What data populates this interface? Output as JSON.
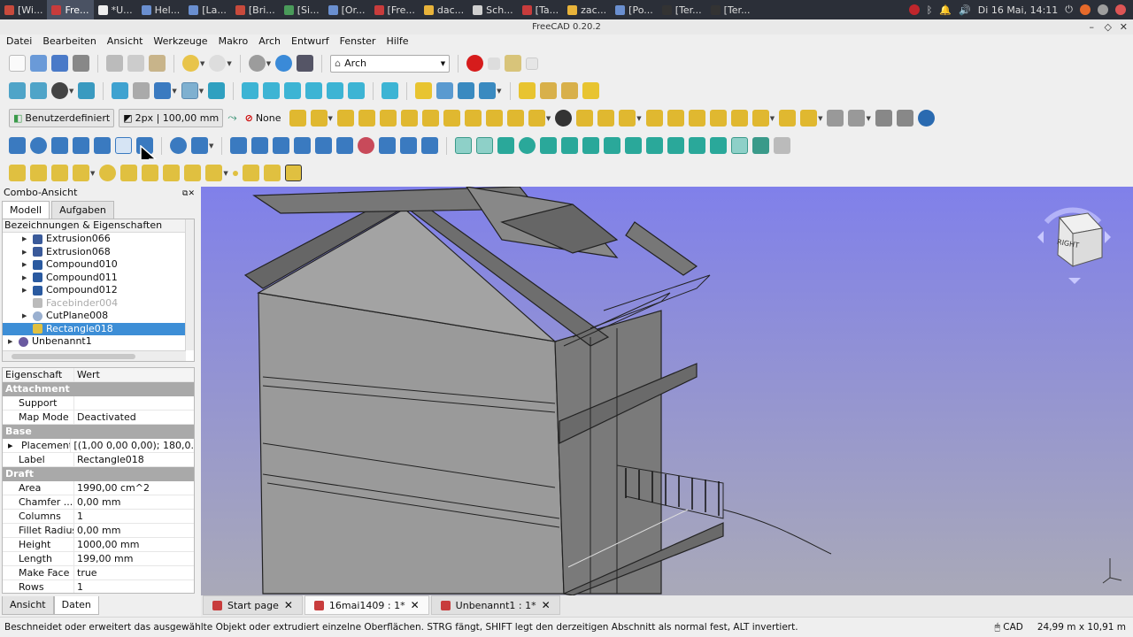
{
  "taskbar": {
    "items": [
      {
        "label": "[Wi...",
        "color": "#c84a3c"
      },
      {
        "label": "Fre...",
        "color": "#c83c3c",
        "active": true
      },
      {
        "label": "*U...",
        "color": "#eeeeee"
      },
      {
        "label": "Hel...",
        "color": "#6a8fd0"
      },
      {
        "label": "[La...",
        "color": "#6a8fd0"
      },
      {
        "label": "[Bri...",
        "color": "#c84a3c"
      },
      {
        "label": "[Si...",
        "color": "#4a9b5a"
      },
      {
        "label": "[Or...",
        "color": "#6a8fd0"
      },
      {
        "label": "[Fre...",
        "color": "#c83c3c"
      },
      {
        "label": "dac...",
        "color": "#e8b33a"
      },
      {
        "label": "Sch...",
        "color": "#d0d0d0"
      },
      {
        "label": "[Ta...",
        "color": "#c83c3c"
      },
      {
        "label": "zac...",
        "color": "#e8b33a"
      },
      {
        "label": "[Po...",
        "color": "#6a8fd0"
      },
      {
        "label": "[Ter...",
        "color": "#333333"
      },
      {
        "label": "[Ter...",
        "color": "#333333"
      }
    ],
    "clock": "Di 16 Mai, 14:11"
  },
  "window": {
    "title": "FreeCAD 0.20.2"
  },
  "menu": [
    "Datei",
    "Bearbeiten",
    "Ansicht",
    "Werkzeuge",
    "Makro",
    "Arch",
    "Entwurf",
    "Fenster",
    "Hilfe"
  ],
  "toolbar": {
    "workbench": "Arch",
    "working_plane": "Benutzerdefiniert",
    "line_style": "2px | 100,00 mm",
    "snap_mode": "None"
  },
  "combo": {
    "title": "Combo-Ansicht",
    "tabs": [
      "Modell",
      "Aufgaben"
    ],
    "tree_header": "Bezeichnungen & Eigenschaften",
    "tree": [
      {
        "label": "Extrusion066",
        "icon": "extrusion",
        "dim": false,
        "sel": false
      },
      {
        "label": "Extrusion068",
        "icon": "extrusion",
        "dim": false,
        "sel": false
      },
      {
        "label": "Compound010",
        "icon": "compound",
        "dim": false,
        "sel": false
      },
      {
        "label": "Compound011",
        "icon": "compound",
        "dim": false,
        "sel": false
      },
      {
        "label": "Compound012",
        "icon": "compound",
        "dim": false,
        "sel": false
      },
      {
        "label": "Facebinder004",
        "icon": "facebinder",
        "dim": true,
        "sel": false
      },
      {
        "label": "CutPlane008",
        "icon": "cutplane",
        "dim": false,
        "sel": false
      },
      {
        "label": "Rectangle018",
        "icon": "rectangle",
        "dim": false,
        "sel": true
      },
      {
        "label": "Unbenannt1",
        "icon": "document",
        "dim": false,
        "sel": false
      }
    ],
    "props_header": {
      "key": "Eigenschaft",
      "value": "Wert"
    },
    "props": [
      {
        "group": "Attachment"
      },
      {
        "key": "Support",
        "value": ""
      },
      {
        "key": "Map Mode",
        "value": "Deactivated"
      },
      {
        "group": "Base"
      },
      {
        "key": "Placement",
        "value": "[(1,00 0,00 0,00); 180,0..."
      },
      {
        "key": "Label",
        "value": "Rectangle018"
      },
      {
        "group": "Draft"
      },
      {
        "key": "Area",
        "value": "1990,00 cm^2"
      },
      {
        "key": "Chamfer ...",
        "value": "0,00 mm"
      },
      {
        "key": "Columns",
        "value": "1"
      },
      {
        "key": "Fillet Radius",
        "value": "0,00 mm"
      },
      {
        "key": "Height",
        "value": "1000,00 mm"
      },
      {
        "key": "Length",
        "value": "199,00 mm"
      },
      {
        "key": "Make Face",
        "value": "true"
      },
      {
        "key": "Rows",
        "value": "1"
      }
    ],
    "bottom_tabs": [
      "Ansicht",
      "Daten"
    ]
  },
  "viewport": {
    "navcube_label": "RIGHT"
  },
  "doc_tabs": [
    {
      "label": "Start page",
      "sel": false
    },
    {
      "label": "16mai1409 : 1*",
      "sel": true
    },
    {
      "label": "Unbenannt1 : 1*",
      "sel": false
    }
  ],
  "status": {
    "message": "Beschneidet oder erweitert das ausgewählte Objekt oder extrudiert einzelne Oberflächen. STRG fängt, SHIFT legt den derzeitigen Abschnitt als normal fest, ALT invertiert.",
    "nav_style": "CAD",
    "dimensions": "24,99 m x 10,91 m"
  },
  "colors": {
    "selection": "#3d8ed6",
    "viewport_top": "#8080ea",
    "viewport_bottom": "#a9a9b8"
  }
}
